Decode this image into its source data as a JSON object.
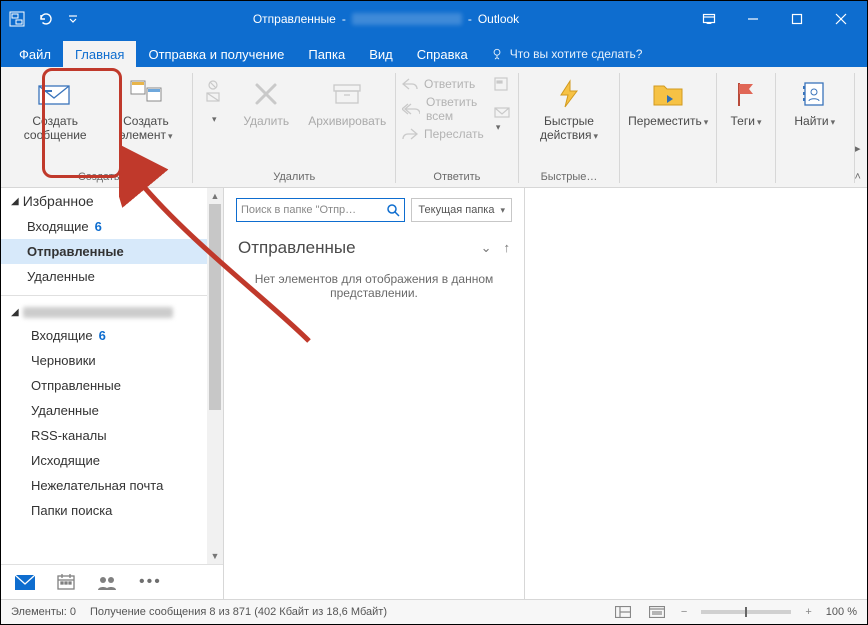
{
  "title": {
    "folder": "Отправленные",
    "app": "Outlook"
  },
  "tabs": [
    "Файл",
    "Главная",
    "Отправка и получение",
    "Папка",
    "Вид",
    "Справка"
  ],
  "tellme": "Что вы хотите сделать?",
  "ribbon": {
    "new": {
      "new_email": "Создать сообщение",
      "new_item": "Создать элемент",
      "group": "Создать"
    },
    "delete": {
      "delete": "Удалить",
      "archive": "Архивировать",
      "group": "Удалить"
    },
    "respond": {
      "reply": "Ответить",
      "reply_all": "Ответить всем",
      "forward": "Переслать",
      "group": "Ответить"
    },
    "quick": {
      "label": "Быстрые действия",
      "group": "Быстрые…"
    },
    "move": {
      "label": "Переместить"
    },
    "tags": {
      "label": "Теги"
    },
    "find": {
      "label": "Найти"
    }
  },
  "nav": {
    "favorites": {
      "header": "Избранное",
      "items": [
        {
          "label": "Входящие",
          "count": "6"
        },
        {
          "label": "Отправленные"
        },
        {
          "label": "Удаленные"
        }
      ]
    },
    "account": {
      "items": [
        {
          "label": "Входящие",
          "count": "6"
        },
        {
          "label": "Черновики"
        },
        {
          "label": "Отправленные"
        },
        {
          "label": "Удаленные"
        },
        {
          "label": "RSS-каналы"
        },
        {
          "label": "Исходящие"
        },
        {
          "label": "Нежелательная почта"
        },
        {
          "label": "Папки поиска"
        }
      ]
    }
  },
  "mid": {
    "search_placeholder": "Поиск в папке \"Отправ…",
    "scope": "Текущая папка",
    "folder": "Отправленные",
    "empty": "Нет элементов для отображения в данном представлении."
  },
  "status": {
    "items": "Элементы: 0",
    "sync": "Получение сообщения 8 из 871 (402 Кбайт из 18,6 Мбайт)",
    "zoom": "100 %"
  }
}
